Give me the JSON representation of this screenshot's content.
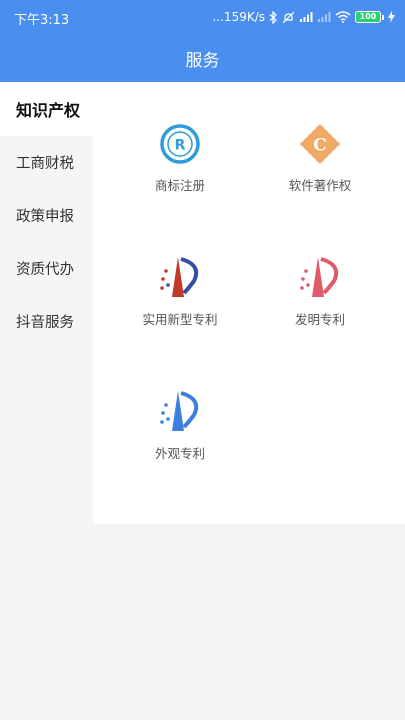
{
  "status_bar": {
    "time": "下午3:13",
    "network_speed": "...159K/s",
    "battery": "100"
  },
  "header": {
    "title": "服务"
  },
  "sidebar": {
    "items": [
      {
        "label": "知识产权",
        "active": true
      },
      {
        "label": "工商财税",
        "active": false
      },
      {
        "label": "政策申报",
        "active": false
      },
      {
        "label": "资质代办",
        "active": false
      },
      {
        "label": "抖音服务",
        "active": false
      }
    ]
  },
  "services": {
    "items": [
      {
        "label": "商标注册",
        "icon": "registered-trademark-icon",
        "color": "#2f9bd7"
      },
      {
        "label": "软件著作权",
        "icon": "copyright-diamond-icon",
        "color": "#f0a866"
      },
      {
        "label": "实用新型专利",
        "icon": "patent-utility-icon",
        "color": "#c0392b"
      },
      {
        "label": "发明专利",
        "icon": "patent-invention-icon",
        "color": "#e05a6a"
      },
      {
        "label": "外观专利",
        "icon": "patent-design-icon",
        "color": "#3d7fe0"
      }
    ]
  }
}
